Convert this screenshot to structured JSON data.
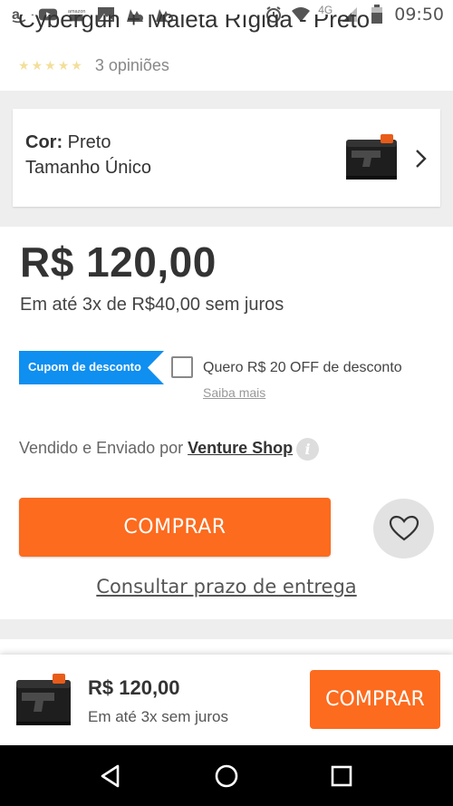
{
  "status_bar": {
    "time": "09:50",
    "network": "4G",
    "left_icons": [
      "amazon-icon",
      "youtube-icon",
      "amazon-music-icon",
      "image-icon",
      "app-icon",
      "app-icon-2"
    ],
    "right_icons": [
      "alarm-icon",
      "wifi-icon",
      "signal-icon",
      "battery-icon"
    ]
  },
  "product": {
    "title": "Cybergun + Maleta Rígida - Preto",
    "rating_count": "3 opiniões",
    "rating_stars": 5
  },
  "variant": {
    "color_label": "Cor:",
    "color_value": "Preto",
    "size_value": "Tamanho Único",
    "thumb_icon": "gun-case-thumbnail-icon",
    "chevron_icon": "chevron-right-icon"
  },
  "pricing": {
    "price": "R$ 120,00",
    "installments": "Em até 3x de R$40,00 sem juros"
  },
  "coupon": {
    "tag_label": "Cupom de desconto",
    "checkbox_text": "Quero R$ 20 OFF de desconto",
    "learn_more": "Saiba mais"
  },
  "seller": {
    "prefix": "Vendido e Enviado por ",
    "name": "Venture Shop",
    "info_icon": "i"
  },
  "actions": {
    "buy_label": "COMPRAR",
    "consult_label": "Consultar prazo de entrega"
  },
  "bottom_bar": {
    "price": "R$ 120,00",
    "installments": "Em até 3x sem juros",
    "buy_label": "COMPRAR"
  },
  "colors": {
    "accent_orange": "#fc6b1e",
    "coupon_blue": "#0f8ff0",
    "page_gray": "#eeeeee"
  }
}
